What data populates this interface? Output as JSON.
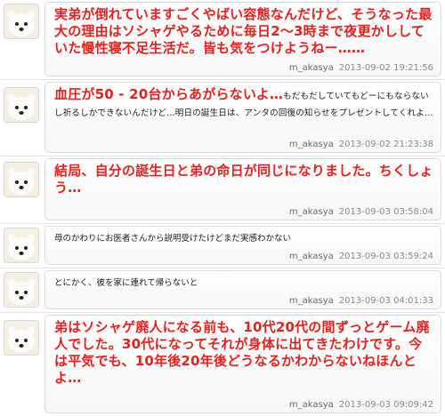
{
  "posts": [
    {
      "text": "実弟が倒れていますごくやばい容態なんだけど、そうなった最大の理由はソシャゲやるために毎日2〜3時まで夜更かししていた慢性寝不足生活だ。皆も気をつけようねー……",
      "tail": "",
      "user": "m_akasya",
      "timestamp": "2013-09-02 19:21:56"
    },
    {
      "text": "血圧が50 - 20台からあがらないよ…",
      "tail": "もだもだしていてもどーにもならないし祈るしかできないんだけど…明日の誕生日は、アンタの回復の知らせをプレゼントしてくれよ…",
      "user": "m_akasya",
      "timestamp": "2013-09-02 21:23:38"
    },
    {
      "text": "結局、自分の誕生日と弟の命日が同じになりました。ちくしょう…",
      "tail": "",
      "user": "m_akasya",
      "timestamp": "2013-09-03 03:58:04"
    },
    {
      "text": "母のかわりにお医者さんから説明受けたけどまだ実感わかない",
      "tail": "",
      "user": "m_akasya",
      "timestamp": "2013-09-03 03:59:24"
    },
    {
      "text": "とにかく、彼を家に連れて帰らないと",
      "tail": "",
      "user": "m_akasya",
      "timestamp": "2013-09-03 04:01:33"
    },
    {
      "text": "弟はソシャゲ廃人になる前も、10代20代の間ずっとゲーム廃人でした。30代になってそれが身体に出てきたわけです。今は平気でも、10年後20年後どうなるかわからないねほんとよ…",
      "tail": "",
      "user": "m_akasya",
      "timestamp": "2013-09-03 09:09:42"
    }
  ]
}
